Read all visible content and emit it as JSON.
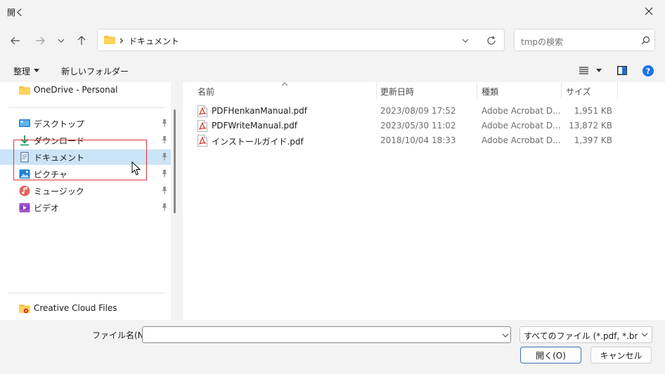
{
  "window": {
    "title": "開く"
  },
  "address": {
    "path_segment": "ドキュメント"
  },
  "search": {
    "placeholder": "tmpの検索"
  },
  "toolbar": {
    "organize_label": "整理",
    "new_folder_label": "新しいフォルダー"
  },
  "nav": {
    "onedrive": "OneDrive - Personal",
    "quick_access": [
      {
        "label": "デスクトップ",
        "icon": "desktop-icon"
      },
      {
        "label": "ダウンロード",
        "icon": "download-icon"
      },
      {
        "label": "ドキュメント",
        "icon": "documents-icon"
      },
      {
        "label": "ピクチャ",
        "icon": "pictures-icon"
      },
      {
        "label": "ミュージック",
        "icon": "music-icon"
      },
      {
        "label": "ビデオ",
        "icon": "videos-icon"
      }
    ],
    "creative_cloud": "Creative Cloud Files"
  },
  "columns": {
    "name": "名前",
    "date": "更新日時",
    "type": "種類",
    "size": "サイズ"
  },
  "files": [
    {
      "name": "PDFHenkanManual.pdf",
      "date": "2023/08/09 17:52",
      "type": "Adobe Acrobat D...",
      "size": "1,951 KB"
    },
    {
      "name": "PDFWriteManual.pdf",
      "date": "2023/05/30 11:02",
      "type": "Adobe Acrobat D...",
      "size": "13,872 KB"
    },
    {
      "name": "インストールガイド.pdf",
      "date": "2018/10/04 18:33",
      "type": "Adobe Acrobat D...",
      "size": "1,397 KB"
    }
  ],
  "bottom": {
    "filename_label": "ファイル名(N):",
    "filename_value": "",
    "filetype_value": "すべてのファイル (*.pdf, *.bmp, *.jp",
    "open_label": "開く(O)",
    "cancel_label": "キャンセル"
  },
  "colors": {
    "selection": "#cce4f7",
    "accent": "#3a6fb5",
    "highlight": "#e0303a",
    "help": "#1a73e8"
  }
}
